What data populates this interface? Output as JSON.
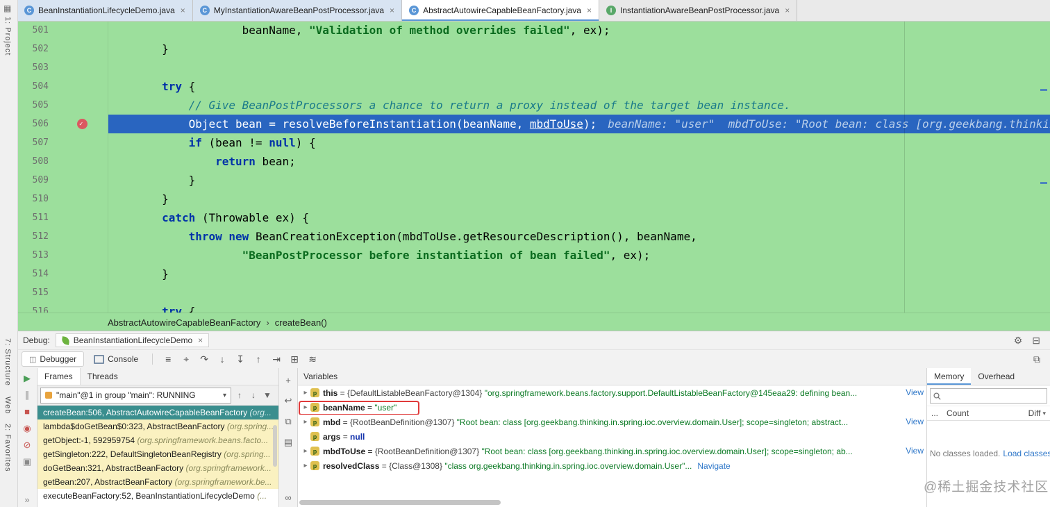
{
  "colors": {
    "editor_background": "#9CDF9C",
    "execution_line_blue": "#2965C0",
    "selected_frame_teal": "#3A8E8E",
    "library_frame_yellow": "#FAF1C0",
    "breakpoint_red": "#DB5860",
    "link_blue": "#2E77C9",
    "string_green": "#0B7A24"
  },
  "left_rail": {
    "top_items": [
      {
        "label": "1: Project"
      }
    ],
    "bottom_items": [
      {
        "label": "7: Structure"
      },
      {
        "label": "Web"
      },
      {
        "label": "2: Favorites"
      }
    ]
  },
  "editor_tabs": [
    {
      "label": "BeanInstantiationLifecycleDemo.java",
      "icon_letter": "C",
      "close": "×"
    },
    {
      "label": "MyInstantiationAwareBeanPostProcessor.java",
      "icon_letter": "C",
      "close": "×"
    },
    {
      "label": "AbstractAutowireCapableBeanFactory.java",
      "icon_letter": "C",
      "close": "×"
    },
    {
      "label": "InstantiationAwareBeanPostProcessor.java",
      "icon_letter": "I",
      "close": "×"
    }
  ],
  "editor": {
    "lines": [
      {
        "num": "501",
        "indent": 20,
        "segments": [
          {
            "t": "beanName, ",
            "c": "plain"
          },
          {
            "t": "\"Validation of method overrides failed\"",
            "c": "str"
          },
          {
            "t": ", ex);",
            "c": "plain"
          }
        ]
      },
      {
        "num": "502",
        "indent": 8,
        "segments": [
          {
            "t": "}",
            "c": "plain"
          }
        ]
      },
      {
        "num": "503",
        "indent": 0,
        "segments": []
      },
      {
        "num": "504",
        "indent": 8,
        "segments": [
          {
            "t": "try",
            "c": "kw"
          },
          {
            "t": " {",
            "c": "plain"
          }
        ]
      },
      {
        "num": "505",
        "indent": 12,
        "segments": [
          {
            "t": "// Give BeanPostProcessors a chance to return a proxy instead of the target bean instance.",
            "c": "com"
          }
        ]
      },
      {
        "num": "506",
        "indent": 12,
        "current": true,
        "breakpoint": true,
        "segments": [
          {
            "t": "Object bean = resolveBeforeInstantiation(beanName, ",
            "c": "cur"
          },
          {
            "t": "mbdToUse",
            "c": "cur-link"
          },
          {
            "t": ");",
            "c": "cur"
          }
        ],
        "hint": "beanName: \"user\"  mbdToUse: \"Root bean: class [org.geekbang.thinkin"
      },
      {
        "num": "507",
        "indent": 12,
        "segments": [
          {
            "t": "if",
            "c": "kw"
          },
          {
            "t": " (bean != ",
            "c": "plain"
          },
          {
            "t": "null",
            "c": "kw"
          },
          {
            "t": ") {",
            "c": "plain"
          }
        ]
      },
      {
        "num": "508",
        "indent": 16,
        "segments": [
          {
            "t": "return",
            "c": "kw"
          },
          {
            "t": " bean;",
            "c": "plain"
          }
        ]
      },
      {
        "num": "509",
        "indent": 12,
        "segments": [
          {
            "t": "}",
            "c": "plain"
          }
        ]
      },
      {
        "num": "510",
        "indent": 8,
        "segments": [
          {
            "t": "}",
            "c": "plain"
          }
        ]
      },
      {
        "num": "511",
        "indent": 8,
        "segments": [
          {
            "t": "catch",
            "c": "kw"
          },
          {
            "t": " (Throwable ex) {",
            "c": "plain"
          }
        ]
      },
      {
        "num": "512",
        "indent": 12,
        "segments": [
          {
            "t": "throw",
            "c": "kw"
          },
          {
            "t": " ",
            "c": "plain"
          },
          {
            "t": "new",
            "c": "kw"
          },
          {
            "t": " BeanCreationException(mbdToUse.getResourceDescription(), beanName,",
            "c": "plain"
          }
        ]
      },
      {
        "num": "513",
        "indent": 20,
        "segments": [
          {
            "t": "\"BeanPostProcessor before instantiation of bean failed\"",
            "c": "str"
          },
          {
            "t": ", ex);",
            "c": "plain"
          }
        ]
      },
      {
        "num": "514",
        "indent": 8,
        "segments": [
          {
            "t": "}",
            "c": "plain"
          }
        ]
      },
      {
        "num": "515",
        "indent": 0,
        "segments": []
      },
      {
        "num": "516",
        "indent": 8,
        "segments": [
          {
            "t": "try",
            "c": "kw"
          },
          {
            "t": " {",
            "c": "plain"
          }
        ]
      }
    ]
  },
  "breadcrumbs": {
    "items": [
      "AbstractAutowireCapableBeanFactory",
      "createBean()"
    ],
    "separator": "›"
  },
  "debug": {
    "label": "Debug:",
    "session_tab": {
      "label": "BeanInstantiationLifecycleDemo",
      "close": "×"
    },
    "header_icons": [
      {
        "name": "settings-gear-icon",
        "glyph": "⚙"
      },
      {
        "name": "hide-panel-icon",
        "glyph": "⊟"
      }
    ],
    "toolbar": {
      "tabs": [
        {
          "label": "Debugger",
          "active": true
        },
        {
          "label": "Console",
          "active": false
        }
      ],
      "icons": [
        {
          "name": "layout-settings-icon",
          "glyph": "≡"
        },
        {
          "name": "show-execution-point-icon",
          "glyph": "⌖"
        },
        {
          "name": "step-over-icon",
          "glyph": "↷"
        },
        {
          "name": "step-into-icon",
          "glyph": "↓"
        },
        {
          "name": "force-step-into-icon",
          "glyph": "↧"
        },
        {
          "name": "step-out-icon",
          "glyph": "↑"
        },
        {
          "name": "run-to-cursor-icon",
          "glyph": "⇥"
        },
        {
          "name": "view-as-table-icon",
          "glyph": "⊞"
        },
        {
          "name": "stream-debugger-icon",
          "glyph": "≋"
        }
      ],
      "right_icon": {
        "name": "restore-layout-icon",
        "glyph": "⧉"
      }
    },
    "left_strip_icons": [
      {
        "name": "resume-icon",
        "glyph": "▶",
        "cls": "green"
      },
      {
        "name": "pause-icon",
        "glyph": "∥",
        "cls": "gray"
      },
      {
        "name": "stop-icon",
        "glyph": "■",
        "cls": "red"
      },
      {
        "name": "view-breakpoints-icon",
        "glyph": "◉",
        "cls": "red"
      },
      {
        "name": "mute-breakpoints-icon",
        "glyph": "⊘",
        "cls": "red"
      },
      {
        "name": "thread-dump-icon",
        "glyph": "▣",
        "cls": "gray"
      },
      {
        "name": "more-icon",
        "glyph": "»",
        "cls": "gray"
      }
    ],
    "frames": {
      "tabs": [
        {
          "label": "Frames",
          "active": true
        },
        {
          "label": "Threads",
          "active": false
        }
      ],
      "thread_selector": {
        "value": "\"main\"@1 in group \"main\": RUNNING",
        "chevron": "▾"
      },
      "nav_icons": [
        {
          "name": "prev-frame-icon",
          "glyph": "↑"
        },
        {
          "name": "next-frame-icon",
          "glyph": "↓"
        },
        {
          "name": "filter-icon",
          "glyph": "▼"
        }
      ],
      "items": [
        {
          "method": "createBean:506, AbstractAutowireCapableBeanFactory",
          "pkg": "(org...",
          "style": "sel"
        },
        {
          "method": "lambda$doGetBean$0:323, AbstractBeanFactory",
          "pkg": "(org.spring...",
          "style": "lib"
        },
        {
          "method": "getObject:-1, 592959754",
          "pkg": "(org.springframework.beans.facto...",
          "style": "lib"
        },
        {
          "method": "getSingleton:222, DefaultSingletonBeanRegistry",
          "pkg": "(org.spring...",
          "style": "lib"
        },
        {
          "method": "doGetBean:321, AbstractBeanFactory",
          "pkg": "(org.springframework...",
          "style": "lib"
        },
        {
          "method": "getBean:207, AbstractBeanFactory",
          "pkg": "(org.springframework.be...",
          "style": "lib"
        },
        {
          "method": "executeBeanFactory:52, BeanInstantiationLifecycleDemo",
          "pkg": "(...",
          "style": "plain"
        }
      ]
    },
    "mid_strip_icons": [
      {
        "name": "add-watch-icon",
        "glyph": "+"
      },
      {
        "name": "back-icon",
        "glyph": "↩"
      },
      {
        "name": "copy-icon",
        "glyph": "⧉"
      },
      {
        "name": "table-view-icon",
        "glyph": "▤"
      },
      {
        "name": "evaluate-icon",
        "glyph": "∞"
      }
    ],
    "variables": {
      "title": "Variables",
      "items": [
        {
          "name": "this",
          "sep": " = ",
          "ref": "{DefaultListableBeanFactory@1304} ",
          "value": "\"org.springframework.beans.factory.support.DefaultListableBeanFactory@145eaa29: defining bean...",
          "view": "View",
          "expandable": true,
          "icon_letter": "p"
        },
        {
          "name": "beanName",
          "sep": " = ",
          "ref": "",
          "value": "\"user\"",
          "boxed": true,
          "expandable": true,
          "icon_letter": "p"
        },
        {
          "name": "mbd",
          "sep": " = ",
          "ref": "{RootBeanDefinition@1307} ",
          "value": "\"Root bean: class [org.geekbang.thinking.in.spring.ioc.overview.domain.User]; scope=singleton; abstract...",
          "view": "View",
          "expandable": true,
          "icon_letter": "p"
        },
        {
          "name": "args",
          "sep": " = ",
          "ref": "",
          "value": "null",
          "null_value": true,
          "expandable": false,
          "icon_letter": "p"
        },
        {
          "name": "mbdToUse",
          "sep": " = ",
          "ref": "{RootBeanDefinition@1307} ",
          "value": "\"Root bean: class [org.geekbang.thinking.in.spring.ioc.overview.domain.User]; scope=singleton; ab...",
          "view": "View",
          "expandable": true,
          "icon_letter": "p"
        },
        {
          "name": "resolvedClass",
          "sep": " = ",
          "ref": "{Class@1308} ",
          "value": "\"class org.geekbang.thinking.in.spring.ioc.overview.domain.User\"...",
          "inline_link": "Navigate",
          "expandable": true,
          "icon_letter": "p"
        }
      ]
    },
    "memory": {
      "tabs": [
        {
          "label": "Memory",
          "active": true
        },
        {
          "label": "Overhead",
          "active": false
        }
      ],
      "columns": {
        "more": "...",
        "count": "Count",
        "diff": "Diff",
        "sort": "▾"
      },
      "empty_text": "No classes loaded.",
      "empty_link": "Load classes"
    }
  },
  "watermark": "@稀土掘金技术社区"
}
